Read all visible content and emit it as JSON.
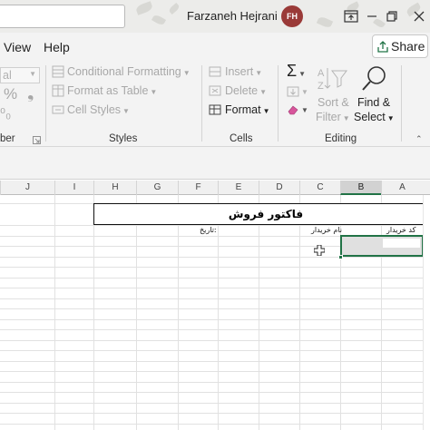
{
  "titlebar": {
    "user_name": "Farzaneh Hejrani",
    "avatar_initials": "FH",
    "accent_color": "#9a3a38"
  },
  "menu": {
    "tabs": [
      "View",
      "Help"
    ],
    "share_label": "Share"
  },
  "ribbon": {
    "number_group": {
      "format_value": "al",
      "percent_symbol": "%",
      "comma_symbol": "❟",
      "label": "ber"
    },
    "styles_group": {
      "conditional_formatting": "Conditional Formatting",
      "format_as_table": "Format as Table",
      "cell_styles": "Cell Styles",
      "label": "Styles"
    },
    "cells_group": {
      "insert": "Insert",
      "delete": "Delete",
      "format": "Format",
      "label": "Cells"
    },
    "editing_group": {
      "sort_filter_line1": "Sort &",
      "sort_filter_line2": "Filter",
      "find_select_line1": "Find &",
      "find_select_line2": "Select",
      "label": "Editing"
    }
  },
  "grid": {
    "columns": [
      "J",
      "I",
      "H",
      "G",
      "F",
      "E",
      "D",
      "C",
      "B",
      "A"
    ],
    "selected_column": "B",
    "cells": {
      "invoice_title": "فاکتور فروش",
      "buyer_code_label": "کد خریدار",
      "buyer_name_label": "نام خریدار",
      "date_label": "تاریخ:"
    },
    "selection_color": "#217346"
  }
}
